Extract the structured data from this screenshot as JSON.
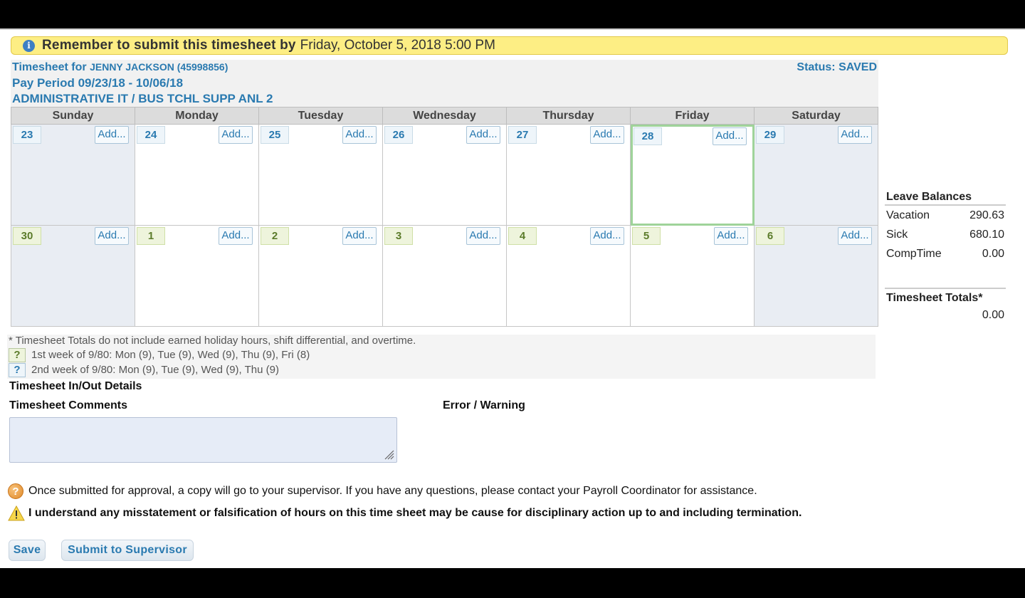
{
  "banner": {
    "lead": "Remember to submit this timesheet by",
    "deadline": "Friday, October 5, 2018 5:00 PM"
  },
  "header": {
    "timesheet_for_label": "Timesheet for",
    "employee": "JENNY JACKSON (45998856)",
    "pay_period": "Pay Period 09/23/18 - 10/06/18",
    "department": "ADMINISTRATIVE IT / BUS TCHL SUPP ANL 2",
    "status": "Status: SAVED"
  },
  "calendar": {
    "days": [
      "Sunday",
      "Monday",
      "Tuesday",
      "Wednesday",
      "Thursday",
      "Friday",
      "Saturday"
    ],
    "add_label": "Add...",
    "week1": [
      "23",
      "24",
      "25",
      "26",
      "27",
      "28",
      "29"
    ],
    "week2": [
      "30",
      "1",
      "2",
      "3",
      "4",
      "5",
      "6"
    ]
  },
  "leave_balances": {
    "title": "Leave Balances",
    "rows": [
      {
        "label": "Vacation",
        "value": "290.63"
      },
      {
        "label": "Sick",
        "value": "680.10"
      },
      {
        "label": "CompTime",
        "value": "0.00"
      }
    ]
  },
  "timesheet_totals": {
    "title": "Timesheet Totals*",
    "value": "0.00"
  },
  "notes": {
    "footnote": "* Timesheet Totals do not include earned holiday hours, shift differential, and overtime.",
    "week1_icon": "?",
    "week1": "1st week of 9/80: Mon (9), Tue (9), Wed (9), Thu (9), Fri (8)",
    "week2_icon": "?",
    "week2": "2nd week of 9/80: Mon (9), Tue (9), Wed (9), Thu (9)"
  },
  "sections": {
    "in_out": "Timesheet In/Out Details",
    "comments": "Timesheet Comments",
    "error": "Error / Warning"
  },
  "comments": {
    "value": ""
  },
  "messages": {
    "info_icon_glyph": "?",
    "info": "Once submitted for approval, a copy will go to your supervisor. If you have any questions, please contact your Payroll Coordinator for assistance.",
    "warning": "I understand any misstatement or falsification of hours on this time sheet may be cause for disciplinary action up to and including termination."
  },
  "buttons": {
    "save": "Save",
    "submit": "Submit to Supervisor"
  },
  "icons": {
    "banner": "info-icon",
    "help": "question-icon",
    "warning": "warning-icon",
    "textarea_grip": "resize-grip-icon"
  },
  "colors": {
    "accent": "#2a7ab0",
    "banner_bg": "#fdee84",
    "today_border": "#9fd39a",
    "weekend_bg": "#e9edf3"
  }
}
